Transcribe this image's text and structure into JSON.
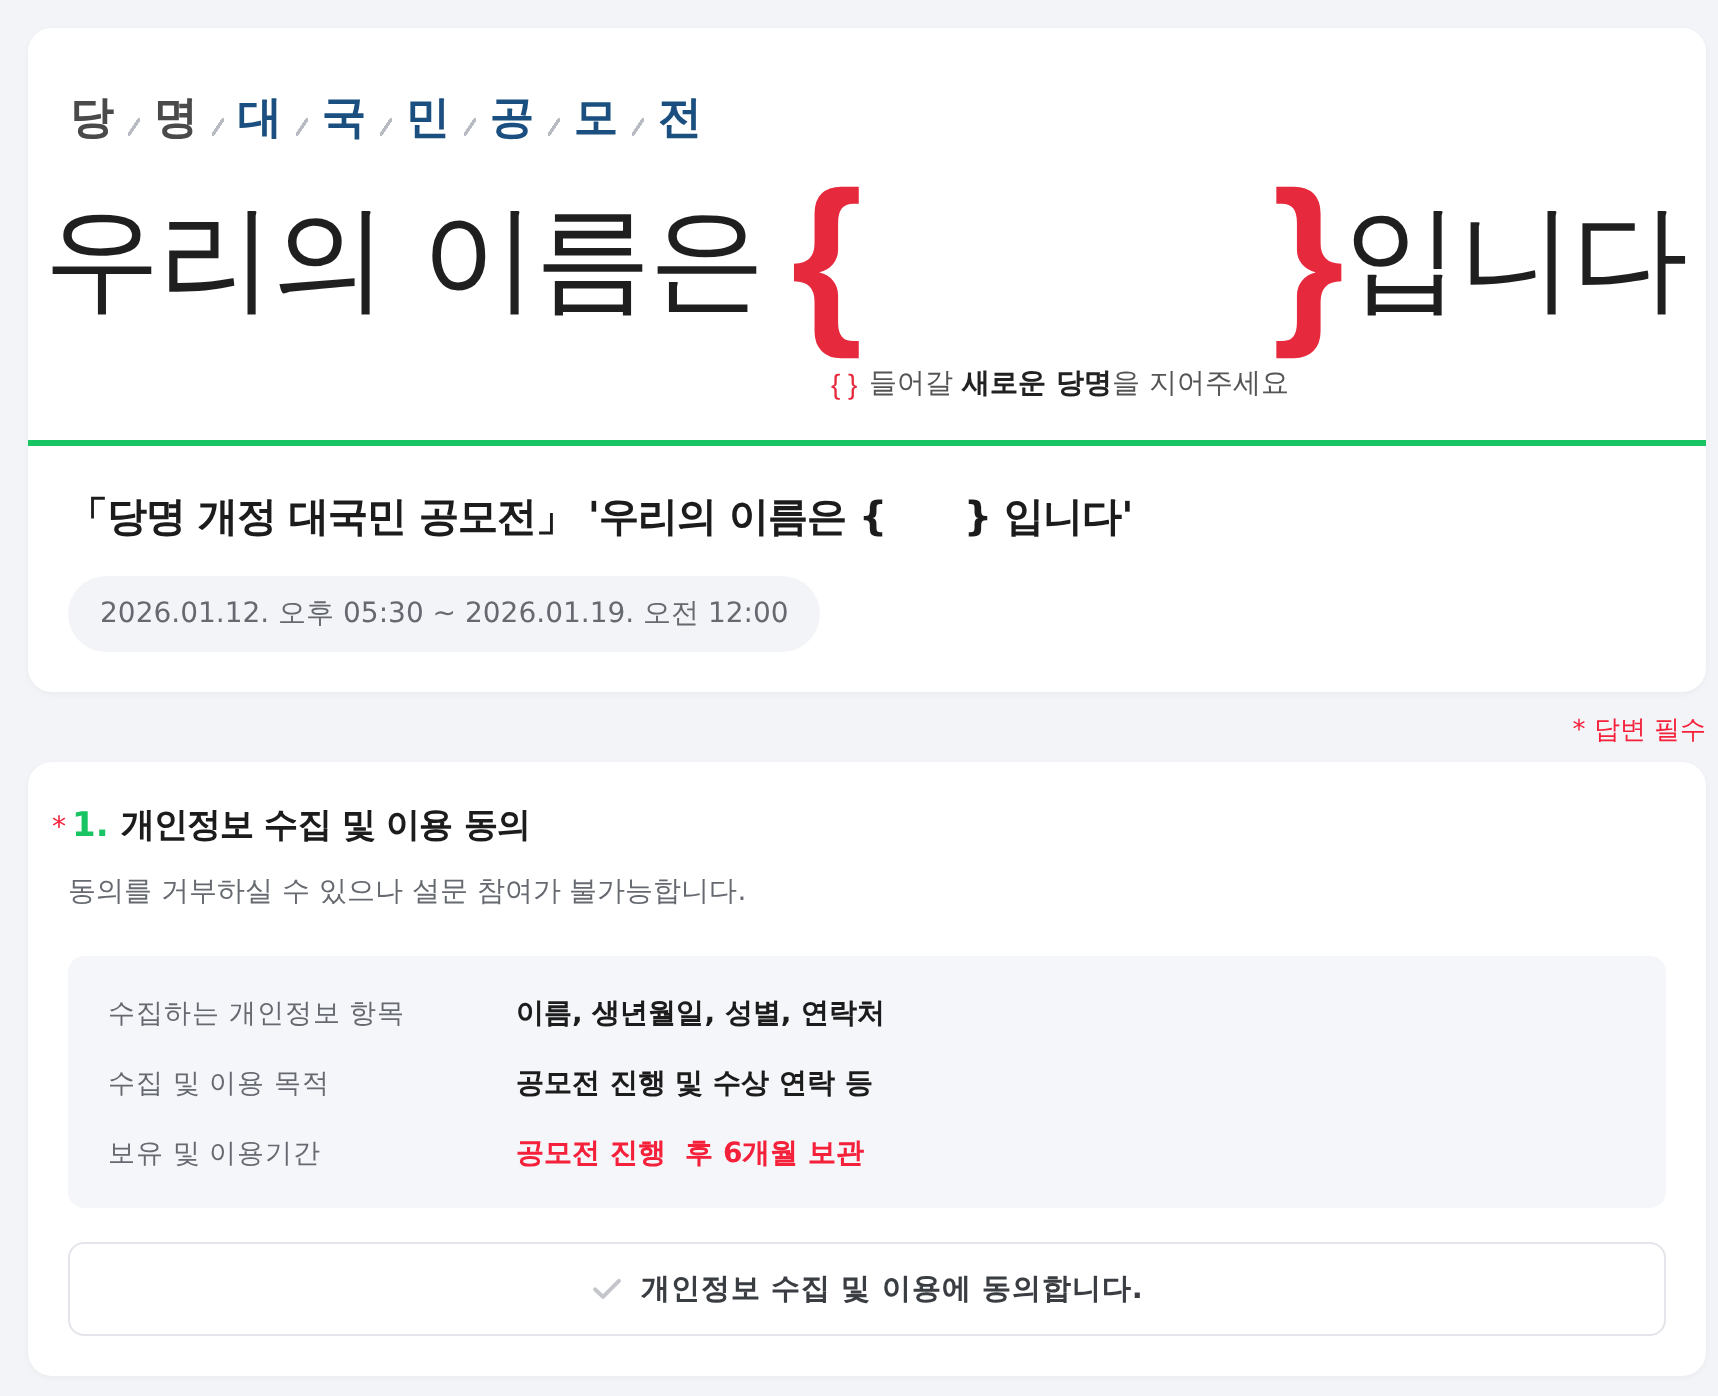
{
  "banner": {
    "tagline": [
      {
        "text": "당",
        "color": "#4a4a4a"
      },
      {
        "text": "명",
        "color": "#4a4a4a"
      },
      {
        "text": "대",
        "color": "#1b4f80"
      },
      {
        "text": "국",
        "color": "#1b4f80"
      },
      {
        "text": "민",
        "color": "#1b4f80"
      },
      {
        "text": "공",
        "color": "#1b4f80"
      },
      {
        "text": "모",
        "color": "#1b4f80"
      },
      {
        "text": "전",
        "color": "#1b4f80"
      }
    ],
    "headline": "우리의 이름은",
    "open_brace": "{",
    "close_brace": "}",
    "headline_end": "입니다",
    "hint_braces": "{ }",
    "hint": "들어갈 **새로운 당명**을 지어주세요"
  },
  "survey": {
    "title": "「당명 개정 대국민 공모전」 '우리의 이름은 {      } 입니다'",
    "period": "2026.01.12. 오후 05:30 ~ 2026.01.19. 오전 12:00"
  },
  "required_note": "* 답변 필수",
  "questions": [
    {
      "required_mark": "*",
      "number": "1.",
      "title": "개인정보 수집 및 이용 동의",
      "description": "동의를 거부하실 수 있으나 설문 참여가 불가능합니다.",
      "details": [
        {
          "label": "수집하는 개인정보 항목",
          "value": "이름, 생년월일, 성별, 연락처",
          "highlight": false
        },
        {
          "label": "수집 및 이용 목적",
          "value": "공모전 진행 및 수상 연락 등",
          "highlight": false
        },
        {
          "label": "보유 및 이용기간",
          "value": "공모전 진행  후 6개월 보관",
          "highlight": true
        }
      ],
      "agree": {
        "label": "개인정보 수집 및 이용에 동의합니다.",
        "checked": false
      }
    }
  ]
}
